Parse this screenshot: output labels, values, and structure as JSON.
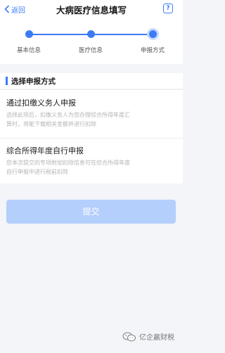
{
  "nav": {
    "back_label": "返回",
    "title": "大病医疗信息填写",
    "help_label": "?"
  },
  "steps": {
    "items": [
      {
        "label": "基本信息",
        "state": "done"
      },
      {
        "label": "医疗信息",
        "state": "done"
      },
      {
        "label": "申报方式",
        "state": "current"
      }
    ]
  },
  "section": {
    "title": "选择申报方式"
  },
  "options": [
    {
      "title": "通过扣缴义务人申报",
      "desc_line1": "选择此项后，扣缴义务人为您办理综合所得年度汇",
      "desc_line2": "算时，将能下载相关金额并进行扣除"
    },
    {
      "title": "综合所得年度自行申报",
      "desc_line1": "您本次提交的专项附加扣除信息可在综合所得年度",
      "desc_line2": "自行申报中进行税前扣除"
    }
  ],
  "submit": {
    "label": "提交",
    "enabled": false
  },
  "watermark": {
    "text": "亿企赢财税"
  },
  "colors": {
    "accent": "#3c7bf6",
    "accent_light": "#b4cffc",
    "background": "#f4f5f9"
  }
}
